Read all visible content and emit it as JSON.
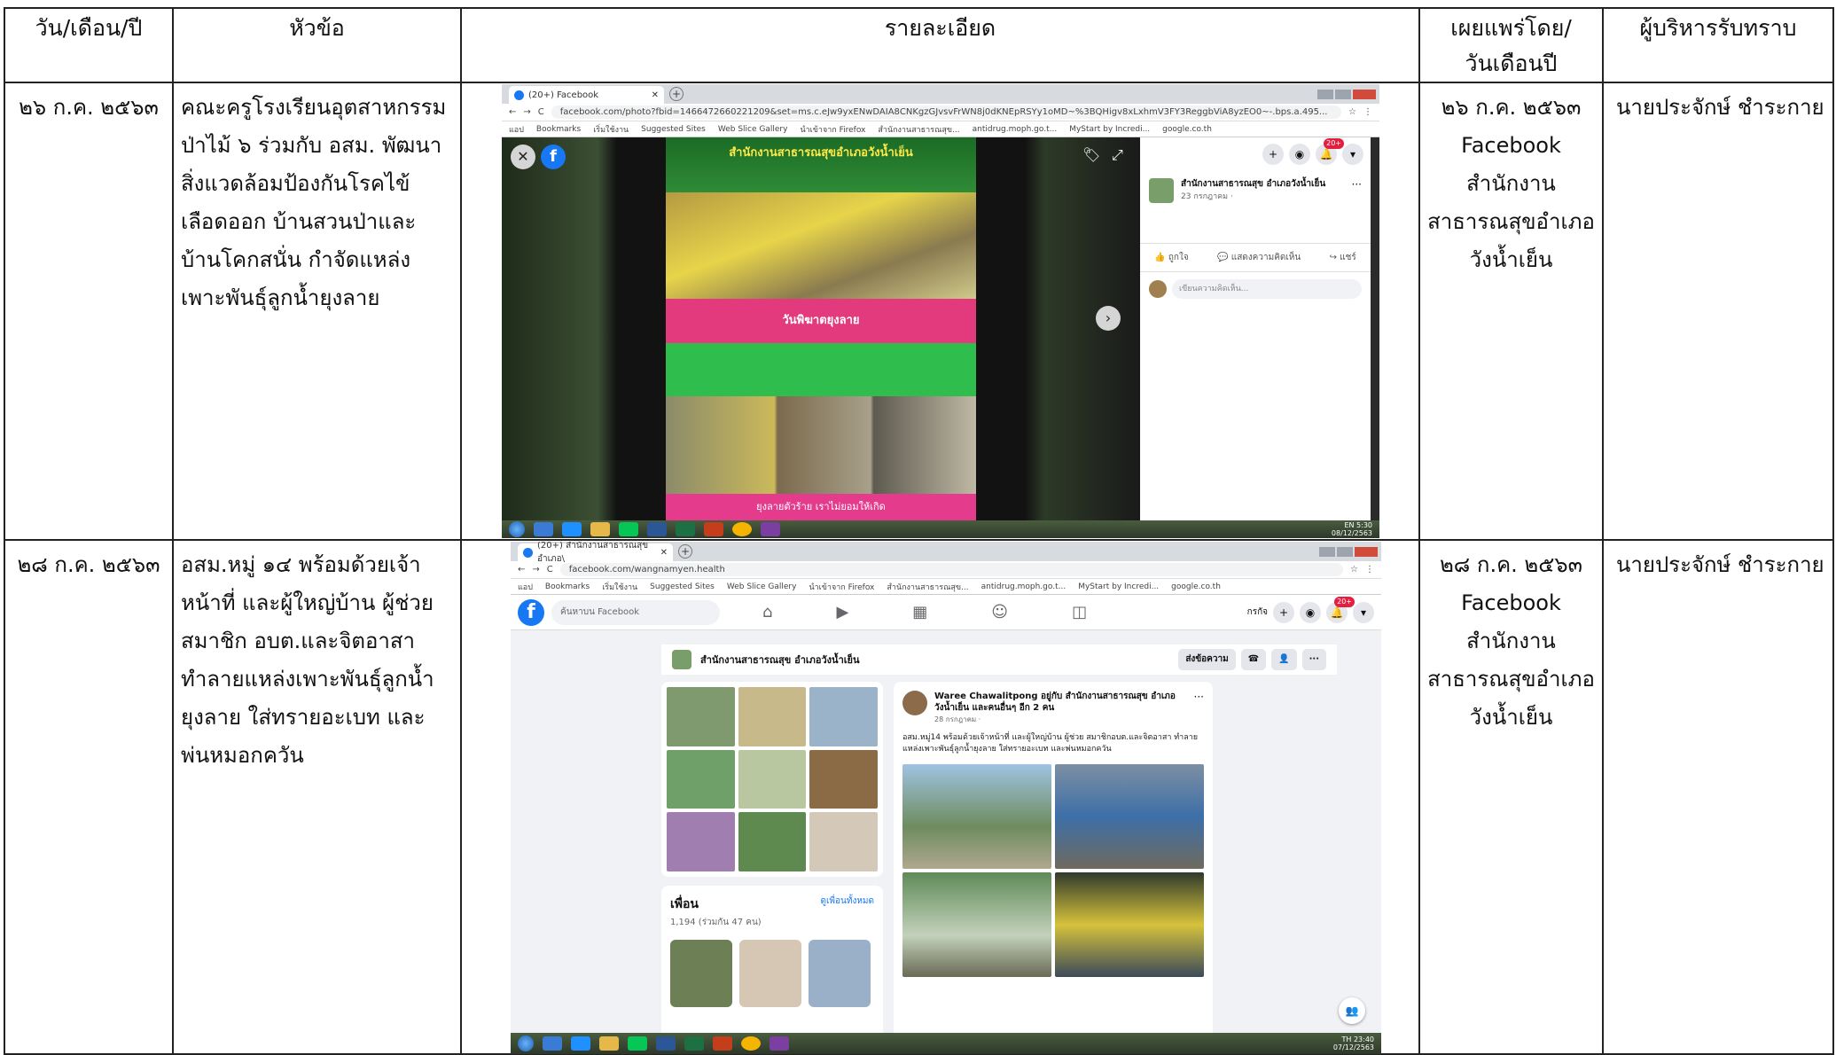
{
  "headers": {
    "date": "วัน/เดือน/ปี",
    "topic": "หัวข้อ",
    "detail": "รายละเอียด",
    "published_line1": "เผยแพร่โดย/",
    "published_line2": "วันเดือนปี",
    "acknowledged": "ผู้บริหารรับทราบ"
  },
  "rows": [
    {
      "date": "๒๖ ก.ค. ๒๕๖๓",
      "topic": "คณะครูโรงเรียนอุตสาหกรรมป่าไม้ ๖ ร่วมกับ อสม. พัฒนาสิ่งแวดล้อมป้องกันโรคไข้เลือดออก บ้านสวนป่าและบ้านโคกสนั่น กำจัดแหล่งเพาะพันธุ์ลูกน้ำยุงลาย",
      "pub_date": "๒๖ ก.ค. ๒๕๖๓",
      "pub_channel": "Facebook",
      "pub_org1": "สำนักงาน",
      "pub_org2": "สาธารณสุขอำเภอ",
      "pub_org3": "วังน้ำเย็น",
      "acknowledged_by": "นายประจักษ์ ชำระกาย"
    },
    {
      "date": "๒๘ ก.ค. ๒๕๖๓",
      "topic": "อสม.หมู่ ๑๔ พร้อมด้วยเจ้าหน้าที่ และผู้ใหญ่บ้าน ผู้ช่วย สมาชิก อบต.และจิตอาสา ทำลายแหล่งเพาะพันธุ์ลูกน้ำยุงลาย ใส่ทรายอะเบท และพ่นหมอกควัน",
      "pub_date": "๒๘ ก.ค. ๒๕๖๓",
      "pub_channel": "Facebook",
      "pub_org1": "สำนักงาน",
      "pub_org2": "สาธารณสุขอำเภอ",
      "pub_org3": "วังน้ำเย็น",
      "acknowledged_by": "นายประจักษ์ ชำระกาย"
    }
  ],
  "screenshot1": {
    "tab_title": "(20+) Facebook",
    "url": "facebook.com/photo?fbid=1466472660221209&set=ms.c.eJw9yxENwDAIA8CNKgzGJvsvFrWN8j0dKNEpRSYy1oMD~%3BQHigv8xLxhmV3FY3ReggbViA8yzEO0~-.bps.a.495...",
    "bookmarks": [
      "แอป",
      "Bookmarks",
      "เริ่มใช้งาน",
      "Suggested Sites",
      "Web Slice Gallery",
      "นำเข้าจาก Firefox",
      "สำนักงานสาธารณสุข...",
      "antidrug.moph.go.t...",
      "MyStart by Incredi...",
      "google.co.th"
    ],
    "poster_header": "สำนักงานสาธารณสุขอำเภอวังน้ำเย็น",
    "poster_banner": "วันพิฆาตยุงลาย",
    "poster_footer": "ยุงลายตัวร้าย เราไม่ยอมให้เกิด",
    "page_name": "สำนักงานสาธารณสุข อำเภอวังน้ำเย็น",
    "post_date": "23 กรกฎาคม · ",
    "like": "ถูกใจ",
    "comment": "แสดงความคิดเห็น",
    "share": "แชร์",
    "comment_placeholder": "เขียนความคิดเห็น...",
    "badge": "20+",
    "tray_lang": "EN",
    "tray_time": "5:30",
    "tray_date": "08/12/2563"
  },
  "screenshot2": {
    "tab_title": "(20+) สำนักงานสาธารณสุข อำเภอ\\",
    "url": "facebook.com/wangnamyen.health",
    "search_placeholder": "ค้นหาบน Facebook",
    "user": "กรกัจ",
    "badge": "20+",
    "page_name": "สำนักงานสาธารณสุข อำเภอวังน้ำเย็น",
    "send_message": "ส่งข้อความ",
    "friends_title": "เพื่อน",
    "friends_link": "ดูเพื่อนทั้งหมด",
    "friends_count": "1,194 (ร่วมกัน 47 คน)",
    "post_author": "Waree Chawalitpong อยู่กับ สำนักงานสาธารณสุข อำเภอวังน้ำเย็น และคนอื่นๆ อีก 2 คน",
    "post_date": "28 กรกฎาคม · ",
    "post_text": "อสม.หมู่14 พร้อมด้วยเจ้าหน้าที่ และผู้ใหญ่บ้าน ผู้ช่วย สมาชิกอบต.และจิตอาสา ทำลายแหล่งเพาะพันธุ์ลูกน้ำยุงลาย ใส่ทรายอะเบท และพ่นหมอกควัน",
    "tray_lang": "TH",
    "tray_time": "23:40",
    "tray_date": "07/12/2563"
  }
}
